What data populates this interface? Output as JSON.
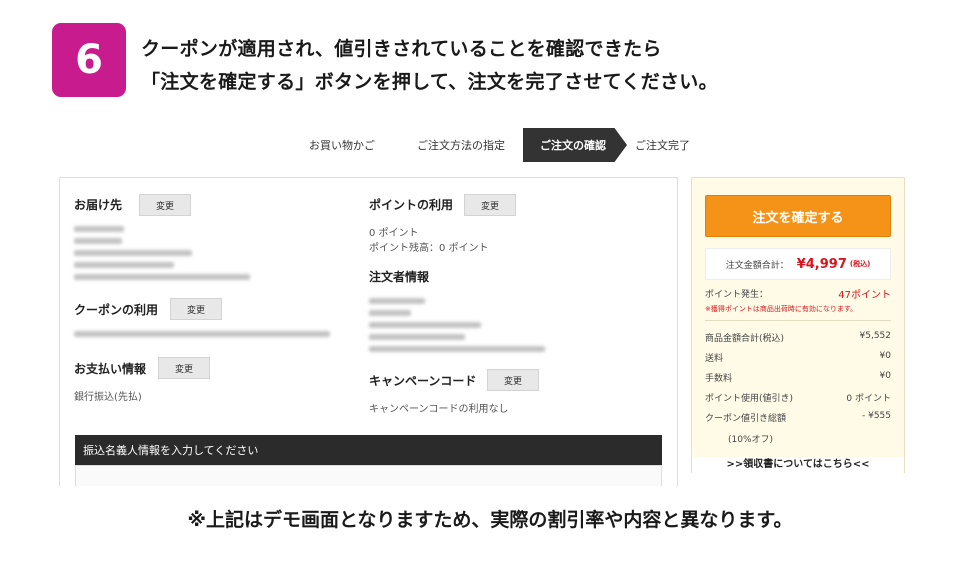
{
  "step": {
    "number": "6",
    "line1": "クーポンが適用され、値引きされていることを確認できたら",
    "line2": "「注文を確定する」ボタンを押して、注文を完了させてください。"
  },
  "progress": {
    "steps": [
      "お買い物かご",
      "ご注文方法の指定",
      "ご注文の確認",
      "ご注文完了"
    ],
    "active_index": 2
  },
  "left_col": {
    "shipping": {
      "title": "お届け先",
      "button": "変更"
    },
    "coupon": {
      "title": "クーポンの利用",
      "button": "変更"
    },
    "payment": {
      "title": "お支払い情報",
      "button": "変更",
      "method": "銀行振込(先払)"
    }
  },
  "right_col": {
    "points": {
      "title": "ポイントの利用",
      "button": "変更",
      "used": "0 ポイント",
      "balance": "ポイント残高：0 ポイント"
    },
    "orderer": {
      "title": "注文者情報"
    },
    "campaign": {
      "title": "キャンペーンコード",
      "button": "変更",
      "note": "キャンペーンコードの利用なし"
    }
  },
  "transfer": {
    "label": "振込名義人情報を入力してください"
  },
  "summary": {
    "confirm_button": "注文を確定する",
    "total_label": "注文金額合計：",
    "total_value": "¥4,997",
    "total_tax": "(税込)",
    "points_label": "ポイント発生：",
    "points_value": "47ポイント",
    "points_note": "※獲得ポイントは商品出荷時に有効になります。",
    "rows": [
      {
        "label": "商品金額合計(税込)",
        "value": "¥5,552"
      },
      {
        "label": "送料",
        "value": "¥0"
      },
      {
        "label": "手数料",
        "value": "¥0"
      },
      {
        "label": "ポイント使用(値引き)",
        "value": "0 ポイント"
      },
      {
        "label": "クーポン値引き総額",
        "value": "- ¥555"
      }
    ],
    "coupon_rate": "(10%オフ)",
    "receipt_link": ">>領収書についてはこちら<<"
  },
  "footnote": "※上記はデモ画面となりますため、実際の割引率や内容と異なります。",
  "colors": {
    "badge": "#c81c8e",
    "confirm_button": "#f59319",
    "price_red": "#d8141c",
    "summary_bg": "#fffbe7"
  }
}
